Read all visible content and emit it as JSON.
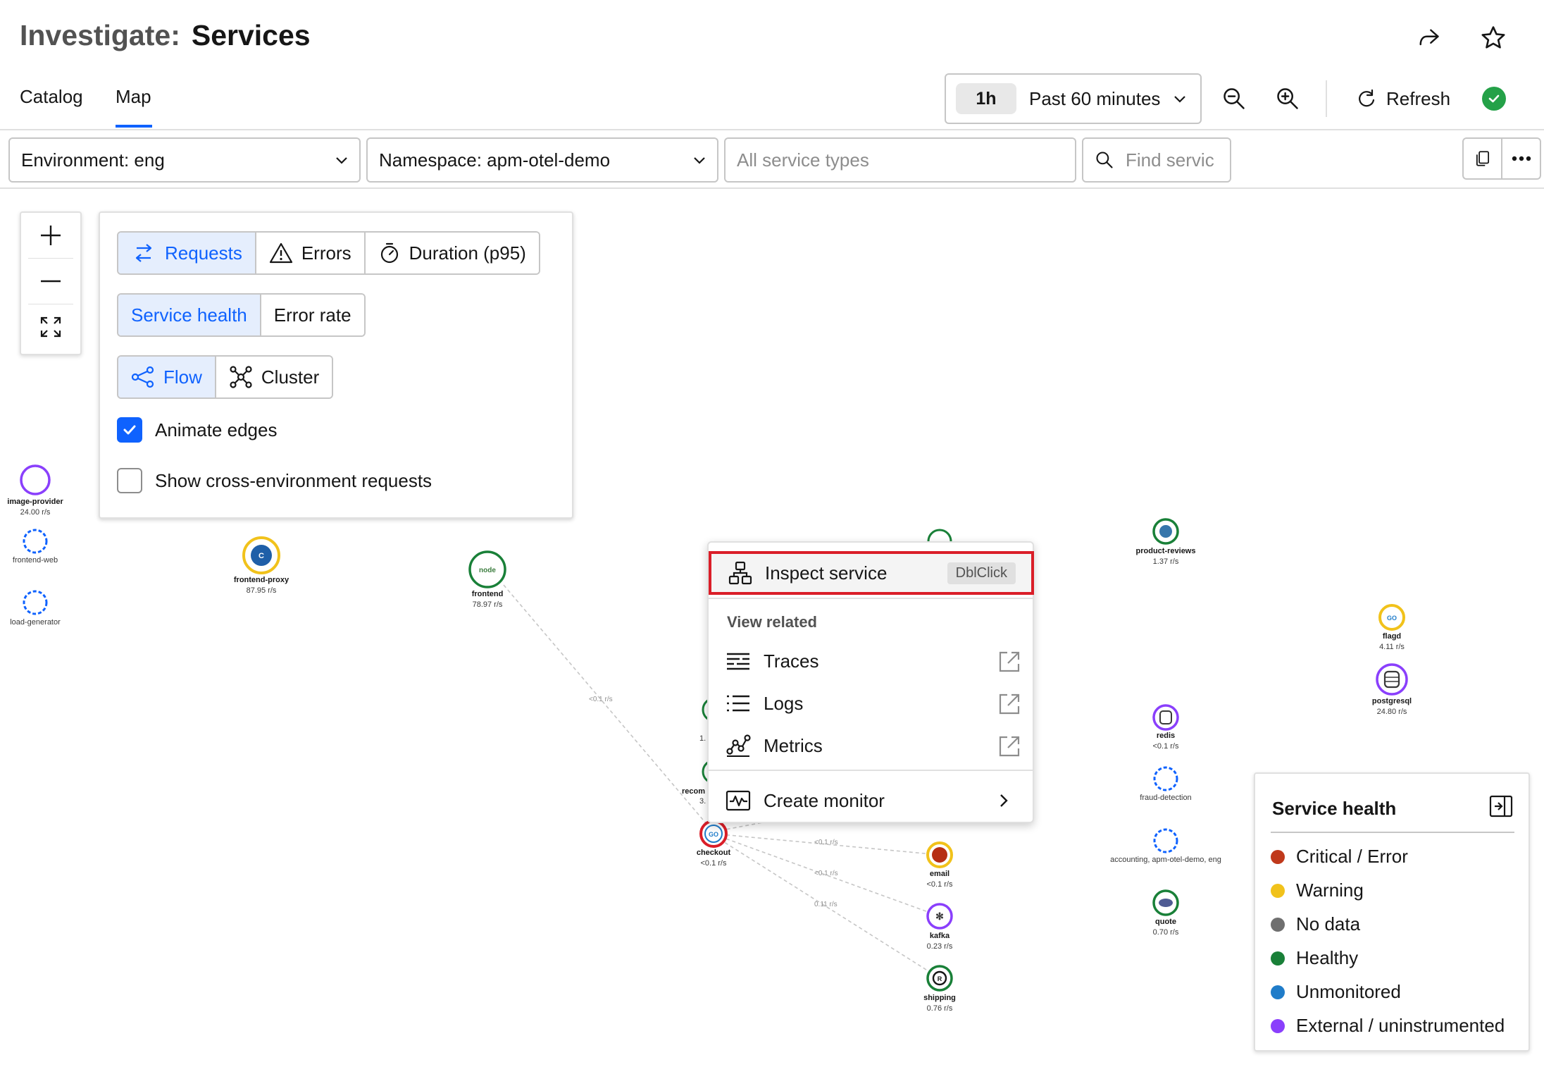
{
  "header": {
    "title_prefix": "Investigate:",
    "title_main": "Services"
  },
  "tabs": [
    {
      "label": "Catalog",
      "active": false
    },
    {
      "label": "Map",
      "active": true
    }
  ],
  "toolbar": {
    "time_chip": "1h",
    "time_label": "Past 60 minutes",
    "refresh_label": "Refresh",
    "status_color": "#24a148"
  },
  "filters": {
    "environment": "Environment: eng",
    "namespace": "Namespace: apm-otel-demo",
    "service_types_placeholder": "All service types",
    "find_placeholder": "Find servic"
  },
  "map_options": {
    "metric_buttons": [
      "Requests",
      "Errors",
      "Duration (p95)"
    ],
    "metric_selected": "Requests",
    "color_buttons": [
      "Service health",
      "Error rate"
    ],
    "color_selected": "Service health",
    "layout_buttons": [
      "Flow",
      "Cluster"
    ],
    "layout_selected": "Flow",
    "animate_edges_label": "Animate edges",
    "animate_edges_checked": true,
    "cross_env_label": "Show cross-environment requests",
    "cross_env_checked": false
  },
  "nodes": [
    {
      "id": "image-provider",
      "name": "image-provider",
      "rate": "24.00 r/s",
      "health": "external"
    },
    {
      "id": "frontend-web",
      "name": "frontend-web",
      "rate": "",
      "health": "unmonitored"
    },
    {
      "id": "load-generator",
      "name": "load-generator",
      "rate": "",
      "health": "unmonitored"
    },
    {
      "id": "frontend-proxy",
      "name": "frontend-proxy",
      "rate": "87.95 r/s",
      "health": "warning"
    },
    {
      "id": "frontend",
      "name": "frontend",
      "rate": "78.97 r/s",
      "health": "healthy"
    },
    {
      "id": "recommendation",
      "name": "recom",
      "rate": "3.",
      "health": "healthy"
    },
    {
      "id": "partial",
      "name": "",
      "rate": "1.",
      "health": "healthy"
    },
    {
      "id": "checkout",
      "name": "checkout",
      "rate": "<0.1 r/s",
      "health": "critical"
    },
    {
      "id": "email",
      "name": "email",
      "rate": "<0.1 r/s",
      "health": "warning"
    },
    {
      "id": "kafka",
      "name": "kafka",
      "rate": "0.23 r/s",
      "health": "external"
    },
    {
      "id": "shipping",
      "name": "shipping",
      "rate": "0.76 r/s",
      "health": "healthy"
    },
    {
      "id": "product-reviews",
      "name": "product-reviews",
      "rate": "1.37 r/s",
      "health": "healthy"
    },
    {
      "id": "redis",
      "name": "redis",
      "rate": "<0.1 r/s",
      "health": "external"
    },
    {
      "id": "fraud-detection",
      "name": "fraud-detection",
      "rate": "",
      "health": "unmonitored"
    },
    {
      "id": "accounting",
      "name": "accounting, apm-otel-demo, eng",
      "rate": "",
      "health": "unmonitored"
    },
    {
      "id": "quote",
      "name": "quote",
      "rate": "0.70 r/s",
      "health": "healthy"
    },
    {
      "id": "flagd",
      "name": "flagd",
      "rate": "4.11 r/s",
      "health": "warning"
    },
    {
      "id": "postgresql",
      "name": "postgresql",
      "rate": "24.80 r/s",
      "health": "external"
    }
  ],
  "edges": [
    {
      "from": "frontend",
      "to": "checkout",
      "label": "<0.1 r/s"
    },
    {
      "from": "checkout",
      "to": "email",
      "label": "<0.1 r/s"
    },
    {
      "from": "checkout",
      "to": "kafka",
      "label": "<0.1 r/s"
    },
    {
      "from": "checkout",
      "to": "shipping",
      "label": "0.11 r/s"
    }
  ],
  "context_menu": {
    "inspect_label": "Inspect service",
    "inspect_shortcut": "DblClick",
    "view_related_header": "View related",
    "items": [
      "Traces",
      "Logs",
      "Metrics"
    ],
    "create_monitor_label": "Create monitor"
  },
  "legend": {
    "title": "Service health",
    "items": [
      {
        "label": "Critical / Error",
        "color": "#c0391b"
      },
      {
        "label": "Warning",
        "color": "#f1c21b"
      },
      {
        "label": "No data",
        "color": "#6f6f6f"
      },
      {
        "label": "Healthy",
        "color": "#198038"
      },
      {
        "label": "Unmonitored",
        "color": "#1f7cc9"
      },
      {
        "label": "External / uninstrumented",
        "color": "#8a3ffc"
      }
    ]
  },
  "colors": {
    "accent": "#0f62fe",
    "healthy": "#198038",
    "warning": "#f1c21b",
    "critical": "#da1e28",
    "external": "#8a3ffc",
    "unmonitored": "#0f62fe"
  },
  "icons": {
    "share": "share-icon",
    "star": "star-icon",
    "zoom_out": "zoom-out-icon",
    "zoom_in": "zoom-in-icon",
    "refresh": "refresh-icon",
    "search": "search-icon",
    "copy": "copy-icon",
    "overflow": "overflow-menu-icon"
  }
}
